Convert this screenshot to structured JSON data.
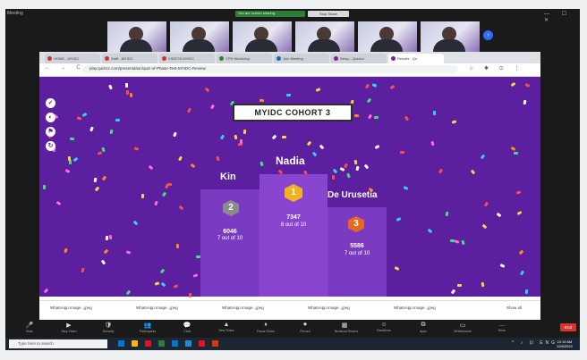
{
  "meeting": {
    "title": "Meeting",
    "share_status": "You are screen sharing",
    "stop_share": "Stop Share",
    "window_controls": "—  ☐  ✕",
    "next_thumbs": "›"
  },
  "browser": {
    "tabs": [
      {
        "label": "HOME - MYIDC",
        "color": "#c0392b"
      },
      {
        "label": "Staff - MYIDC",
        "color": "#c0392b"
      },
      {
        "label": "VIDEOS MYIDC",
        "color": "#c0392b"
      },
      {
        "label": "CPD Workshop",
        "color": "#2e7d32"
      },
      {
        "label": "Join Meeting",
        "color": "#1565c0"
      },
      {
        "label": "Setup - Quizizz",
        "color": "#7b1fa2"
      },
      {
        "label": "Results - Qu",
        "color": "#7b1fa2"
      }
    ],
    "nav_icons": "← → C",
    "url": "play.quizizz.com/presentation/quiz-of-Phase-Test-MYIDC-Review",
    "ext_icons": "☆ ✱ ⊙ ⋮"
  },
  "quiz": {
    "side_icons": [
      "✓",
      "◐",
      "⚑",
      "↻"
    ],
    "title": "MYIDC COHORT 3",
    "podium": [
      {
        "rank": "2",
        "name": "Kin",
        "score": "6046",
        "correct": "7 out of 10",
        "badge_color": "#8a8a8a"
      },
      {
        "rank": "1",
        "name": "Nadia",
        "score": "7347",
        "correct": "8 out of 10",
        "badge_color": "#f2b21f"
      },
      {
        "rank": "3",
        "name": "De Urusetia",
        "score": "5586",
        "correct": "7 out of 10",
        "badge_color": "#e8691d"
      }
    ]
  },
  "downloads": {
    "items": [
      "WhatsApp Image...jpeg",
      "WhatsApp Image...jpeg",
      "WhatsApp Image...jpeg",
      "WhatsApp Image...jpeg",
      "WhatsApp Image...jpeg"
    ],
    "show_all": "Show all"
  },
  "controls": {
    "items": [
      {
        "icon": "🎤",
        "label": "Mute"
      },
      {
        "icon": "▶",
        "label": "Stop Video"
      },
      {
        "icon": "🛡",
        "label": "Security"
      },
      {
        "icon": "👥",
        "label": "Participants"
      },
      {
        "icon": "💬",
        "label": "Chat"
      },
      {
        "icon": "▲",
        "label": "New Share"
      },
      {
        "icon": "⏸",
        "label": "Pause Share"
      },
      {
        "icon": "⏺",
        "label": "Record"
      },
      {
        "icon": "▦",
        "label": "Breakout Rooms"
      },
      {
        "icon": "☺",
        "label": "Reactions"
      },
      {
        "icon": "⧉",
        "label": "Apps"
      },
      {
        "icon": "▭",
        "label": "Whiteboards"
      },
      {
        "icon": "…",
        "label": "More"
      }
    ],
    "end": "End"
  },
  "taskbar": {
    "search_placeholder": "Type here to search",
    "tray": "^ ♪ ⊡ ENG",
    "time": "10:19 AM",
    "date": "12/8/2022",
    "app_colors": [
      "#0078d4",
      "#ffb900",
      "#e81123",
      "#2d7d32",
      "#0078d4",
      "#2b88d8",
      "#e81123",
      "#d83b01"
    ]
  },
  "palette": {
    "stage_purple": "#5b1fa0",
    "podium_purple": "#7a3bc2"
  }
}
